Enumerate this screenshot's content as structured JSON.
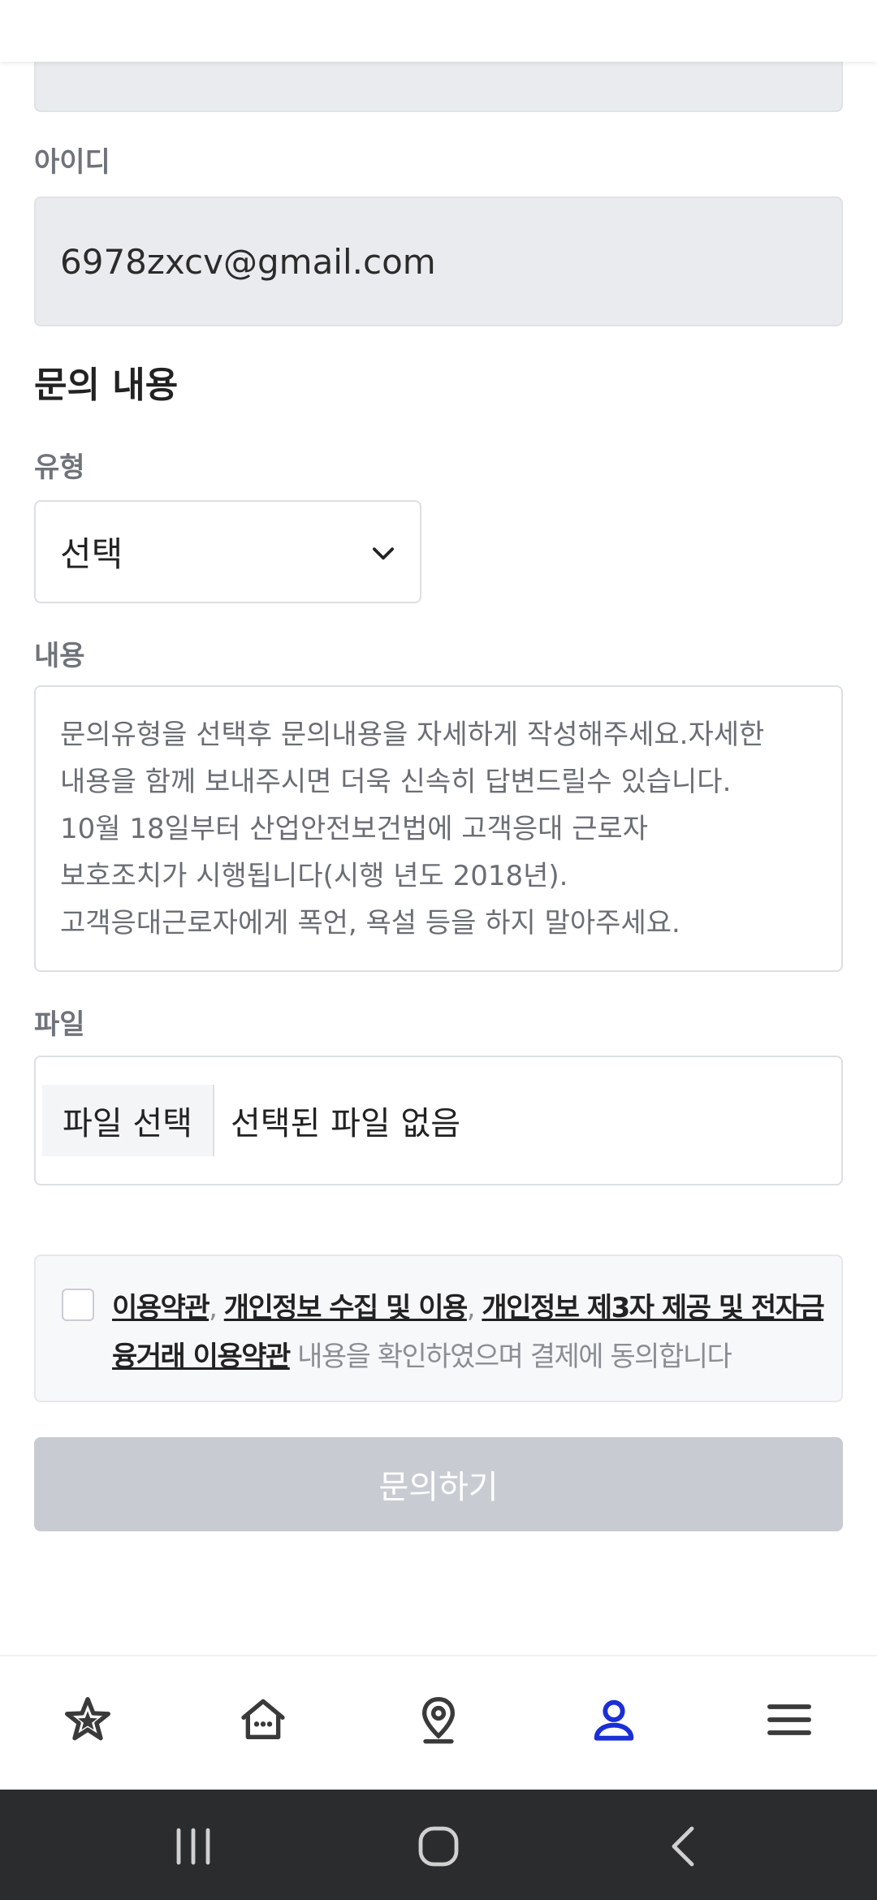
{
  "account": {
    "id_label": "아이디",
    "id_value": "6978zxcv@gmail.com"
  },
  "inquiry": {
    "section_title": "문의 내용",
    "type_label": "유형",
    "type_selected": "선택",
    "content_label": "내용",
    "content_placeholder_lines": [
      "문의유형을 선택후 문의내용을 자세하게 작성해주세요.자세한",
      "내용을 함께 보내주시면 더욱 신속히 답변드릴수 있습니다.",
      "10월 18일부터 산업안전보건법에 고객응대 근로자",
      "보호조치가 시행됩니다(시행 년도 2018년).",
      "고객응대근로자에게 폭언, 욕설 등을 하지 말아주세요."
    ],
    "file_label": "파일",
    "file_button": "파일 선택",
    "file_status": "선택된 파일 없음"
  },
  "agreement": {
    "terms": "이용약관",
    "sep1": ", ",
    "privacy": "개인정보 수집 및 이용",
    "sep2": ", ",
    "third_party_line1": "개인정보 제3자 제공 및 전자금",
    "third_party_line2": "융거래 이용약관",
    "suffix": " 내용을 확인하였으며 결제에 동의합니다"
  },
  "submit_label": "문의하기",
  "bottom_nav": {
    "items": [
      "star-icon",
      "home-icon",
      "location-pin-icon",
      "user-icon",
      "menu-icon"
    ],
    "active": "user-icon",
    "active_color": "#1a2fd6",
    "inactive_color": "#3a3a3a"
  },
  "system_nav": [
    "recents-icon",
    "home-circle-icon",
    "back-icon"
  ]
}
